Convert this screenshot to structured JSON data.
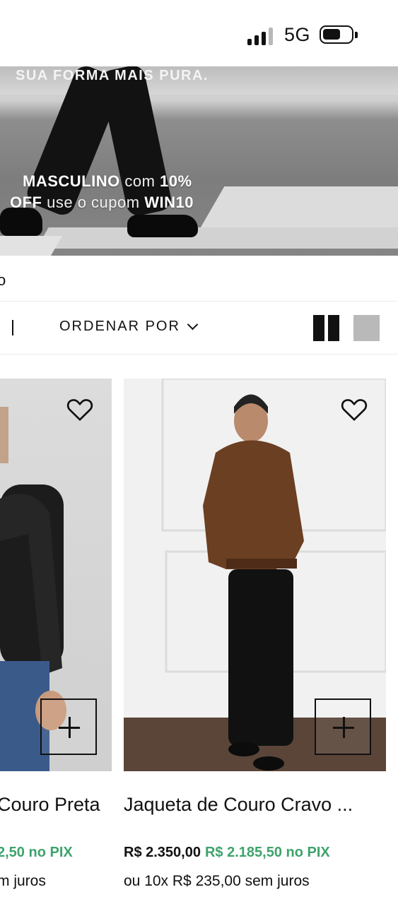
{
  "status_bar": {
    "network": "5G",
    "icons": [
      "signal-icon",
      "battery-icon"
    ]
  },
  "banner": {
    "tagline": "SUA FORMA MAIS PURA.",
    "promo_part1": "MASCULINO",
    "promo_part2": " com ",
    "promo_part3": "10%",
    "promo_part4": "OFF",
    "promo_part5": " use o cupom ",
    "promo_code": "WIN10"
  },
  "breadcrumb": {
    "text": "o"
  },
  "toolbar": {
    "sort_label": "ORDENAR POR",
    "view_icons": [
      "grid-2-icon",
      "grid-1-icon"
    ]
  },
  "products": [
    {
      "title": "Couro Preta",
      "price_pix": "2,50 no PIX",
      "installments": "m juros"
    },
    {
      "title": "Jaqueta de Couro Cravo ...",
      "price": "R$ 2.350,00",
      "price_pix": "R$ 2.185,50 no PIX",
      "installments": "ou 10x R$ 235,00 sem juros"
    }
  ],
  "colors": {
    "pix_green": "#3ea36b",
    "text": "#111111"
  }
}
